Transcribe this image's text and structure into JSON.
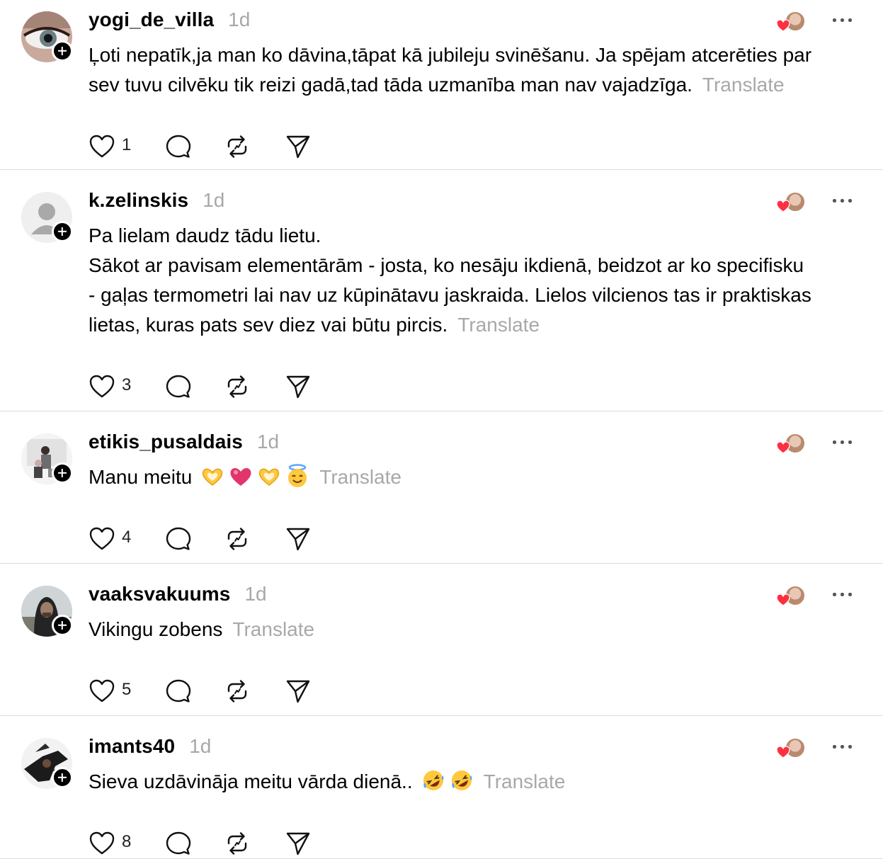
{
  "posts": [
    {
      "username": "yogi_de_villa",
      "time": "1d",
      "avatar_icon": "eye-photo",
      "lines": [
        "Ļoti nepatīk,ja man ko dāvina,tāpat kā jubileju svinēšanu. Ja spējam atcerēties par",
        "sev tuvu cilvēku tik reizi gadā,tad tāda uzmanība man nav vajadzīga."
      ],
      "emojis": [],
      "translate": "Translate",
      "likes": "1"
    },
    {
      "username": "k.zelinskis",
      "time": "1d",
      "avatar_icon": "default-avatar",
      "lines": [
        "Pa lielam daudz tādu lietu.",
        "Sākot ar pavisam elementārām - josta, ko nesāju ikdienā, beidzot ar ko specifisku",
        "- gaļas termometri lai nav uz kūpinātavu jaskraida. Lielos vilcienos tas ir praktiskas",
        "lietas, kuras pats sev diez vai būtu pircis."
      ],
      "emojis": [],
      "translate": "Translate",
      "likes": "3"
    },
    {
      "username": "etikis_pusaldais",
      "time": "1d",
      "avatar_icon": "people-photo",
      "lines": [
        "Manu meitu"
      ],
      "emojis": [
        "heart-hands",
        "pink-heart",
        "heart-hands",
        "smiling-halo-face"
      ],
      "translate": "Translate",
      "likes": "4"
    },
    {
      "username": "vaaksvakuums",
      "time": "1d",
      "avatar_icon": "hooded-man-photo",
      "lines": [
        "Vikingu zobens"
      ],
      "emojis": [],
      "translate": "Translate",
      "likes": "5"
    },
    {
      "username": "imants40",
      "time": "1d",
      "avatar_icon": "dark-photo",
      "lines": [
        "Sieva uzdāvināja meitu vārda dienā.."
      ],
      "emojis": [
        "rolling-laughing-face",
        "rolling-laughing-face"
      ],
      "translate": "Translate",
      "likes": "8"
    }
  ],
  "colors": {
    "muted": "#a8a8a8",
    "heart": "#ff3040",
    "divider": "#dcdcdc"
  }
}
